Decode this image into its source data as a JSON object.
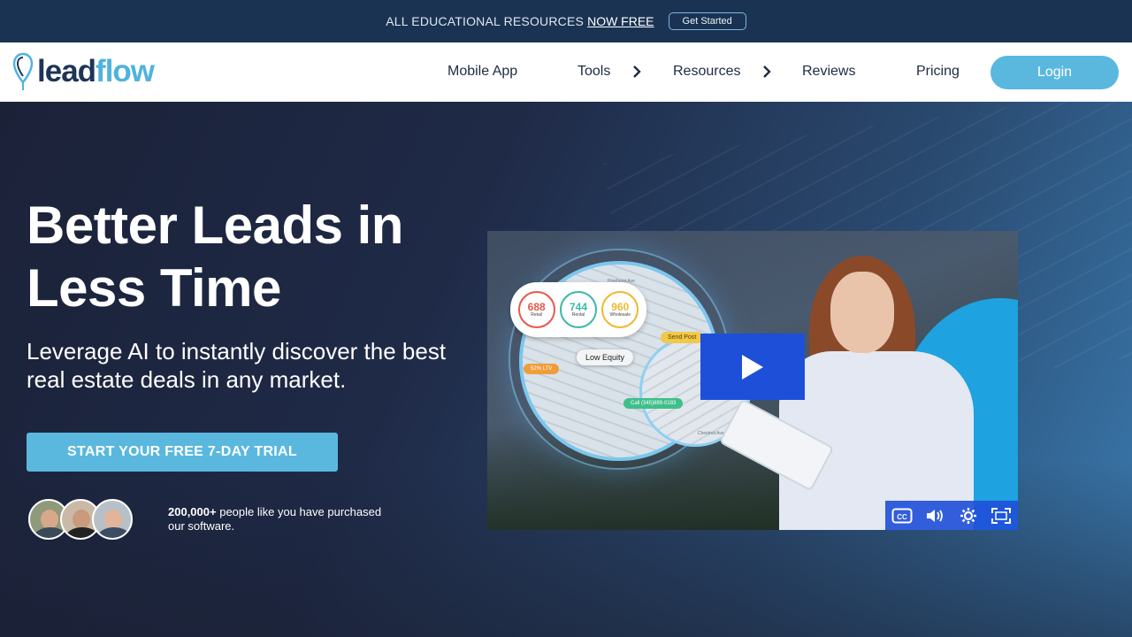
{
  "announcement": {
    "text": "ALL EDUCATIONAL RESOURCES",
    "link": "NOW FREE",
    "button": "Get Started"
  },
  "nav": {
    "logo": {
      "part1": "lead",
      "part2": "flow"
    },
    "items": [
      {
        "label": "Mobile App",
        "has_submenu": false
      },
      {
        "label": "Tools",
        "has_submenu": true
      },
      {
        "label": "Resources",
        "has_submenu": true
      },
      {
        "label": "Reviews",
        "has_submenu": false
      },
      {
        "label": "Pricing",
        "has_submenu": false
      }
    ],
    "login": "Login"
  },
  "hero": {
    "headline_line1": "Better Leads in",
    "headline_line2": "Less Time",
    "subhead": "Leverage AI to instantly discover the best real estate deals in any market.",
    "cta": "START YOUR FREE 7-DAY TRIAL",
    "social_count": "200,000+",
    "social_text": "people like you have purchased our software."
  },
  "video": {
    "stats": [
      {
        "value": "688",
        "label": "Retail"
      },
      {
        "value": "744",
        "label": "Rental"
      },
      {
        "value": "960",
        "label": "Wholesale"
      }
    ],
    "tag_equity": "Low Equity",
    "tag_ltv": "52% LTV",
    "tag_call": "Call (345)889-0183",
    "tag_send": "Send Post",
    "street1": "Pinehurst Ave",
    "street2": "Chestnut Ave",
    "controls": [
      "cc-icon",
      "volume-icon",
      "settings-icon",
      "fullscreen-icon"
    ]
  },
  "colors": {
    "announce_bg": "#1a3352",
    "accent": "#5ab8df",
    "logo_dark": "#1d3557",
    "play_blue": "#1e4fd8"
  }
}
